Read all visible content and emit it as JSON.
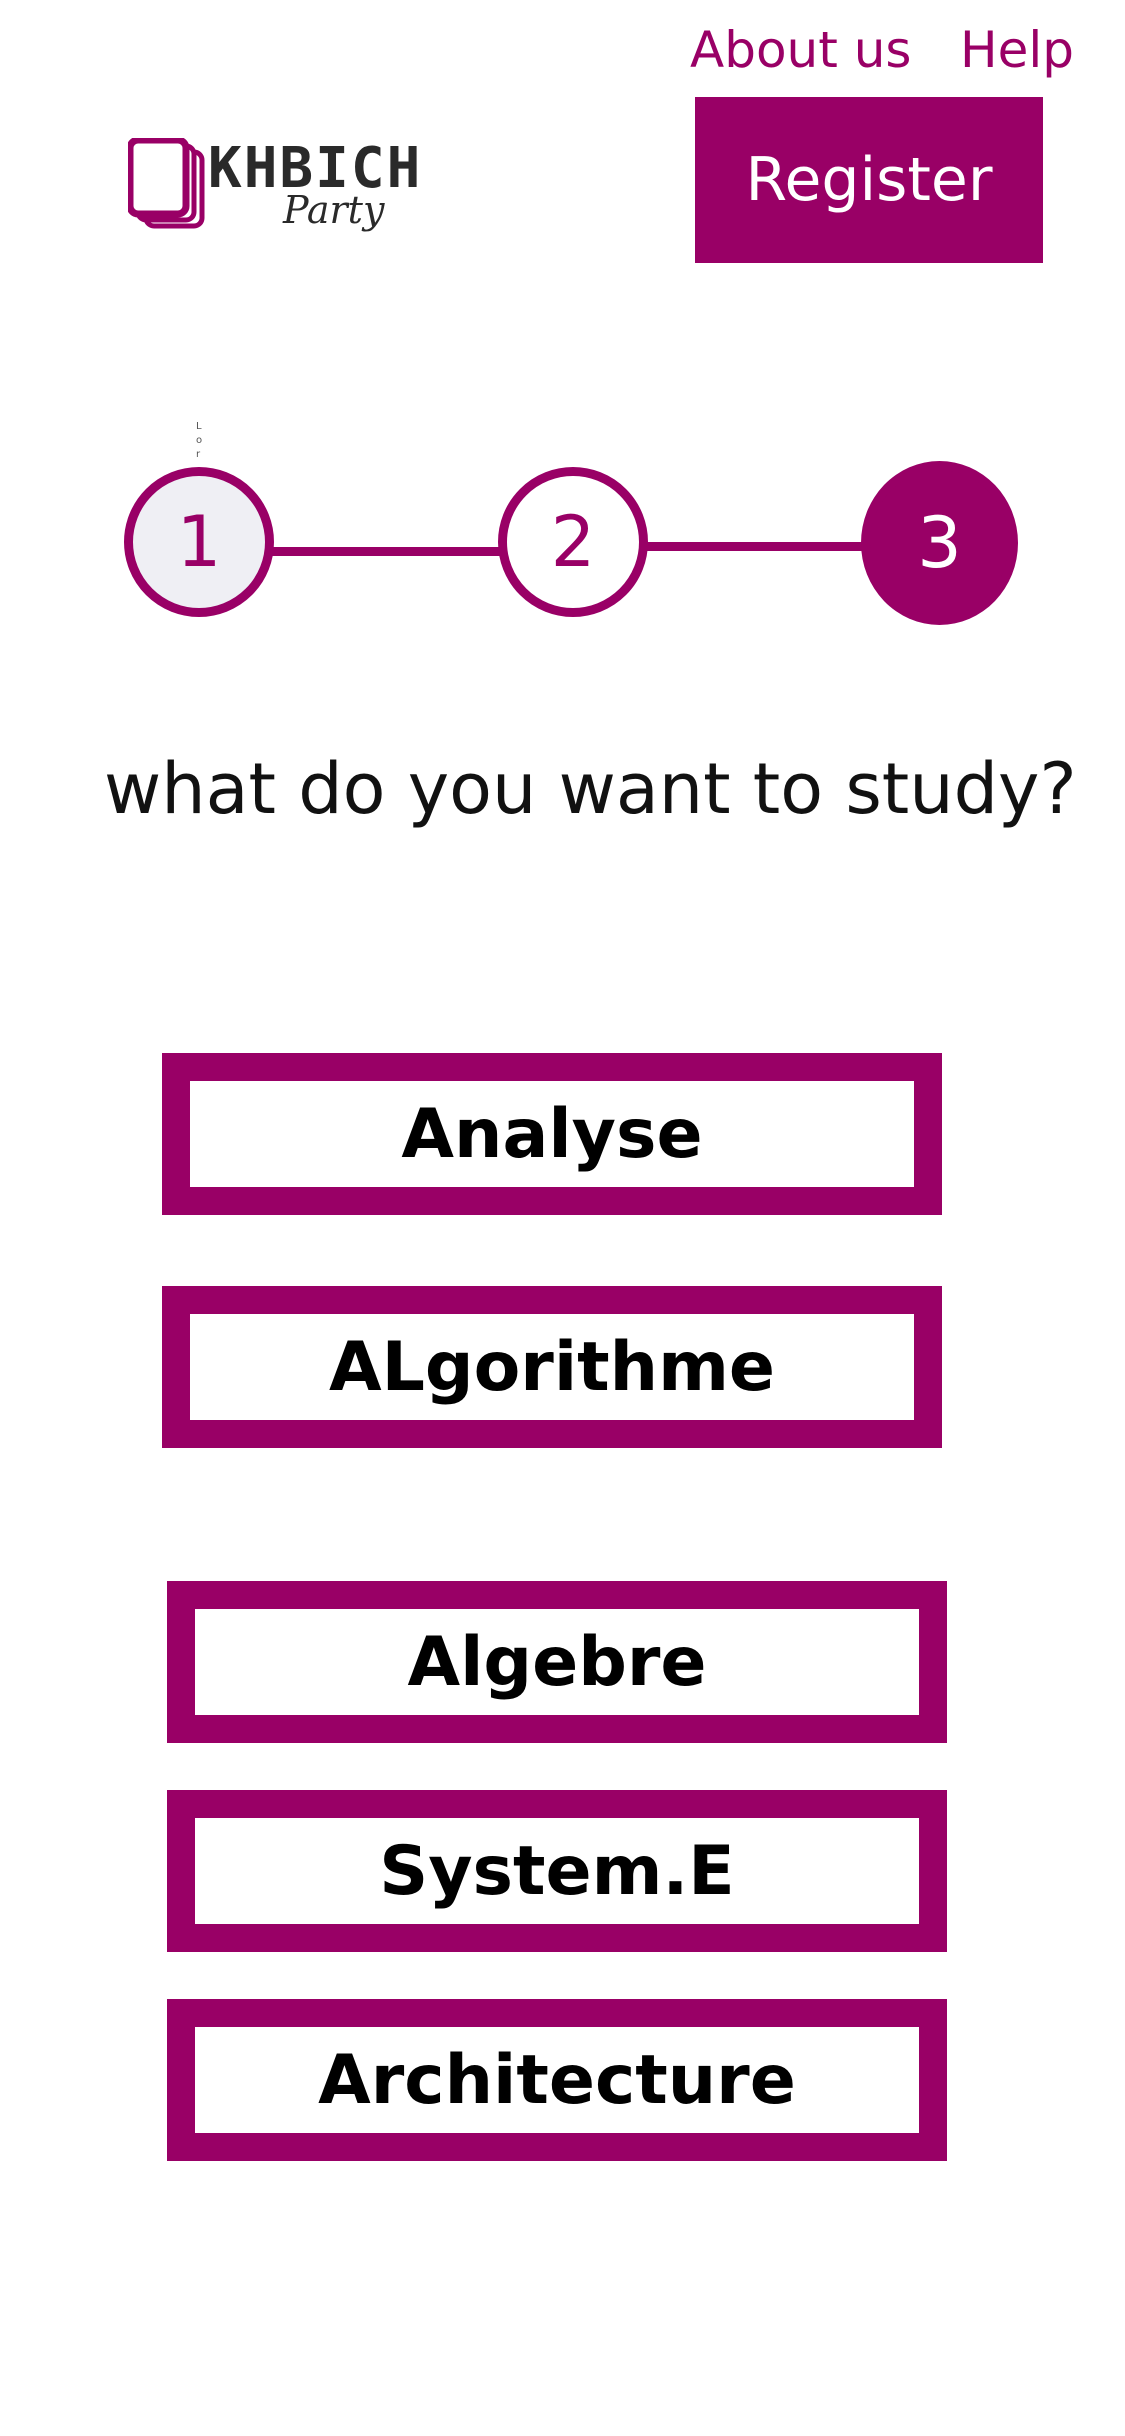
{
  "header": {
    "about_label": "About us",
    "help_label": "Help",
    "register_label": "Register"
  },
  "logo": {
    "title": "KHBICH",
    "subtitle": "Party",
    "icon": "stacked-cards-icon"
  },
  "stepper": {
    "steps": [
      "1",
      "2",
      "3"
    ],
    "active_step": 3,
    "tiny_label": "Lor"
  },
  "question": "what do you want to study?",
  "subjects": [
    "Analyse",
    "ALgorithme",
    "Algebre",
    "System.E",
    "Architecture"
  ],
  "colors": {
    "accent": "#990066",
    "step1_fill": "#efeff4",
    "background": "#ffffff"
  }
}
